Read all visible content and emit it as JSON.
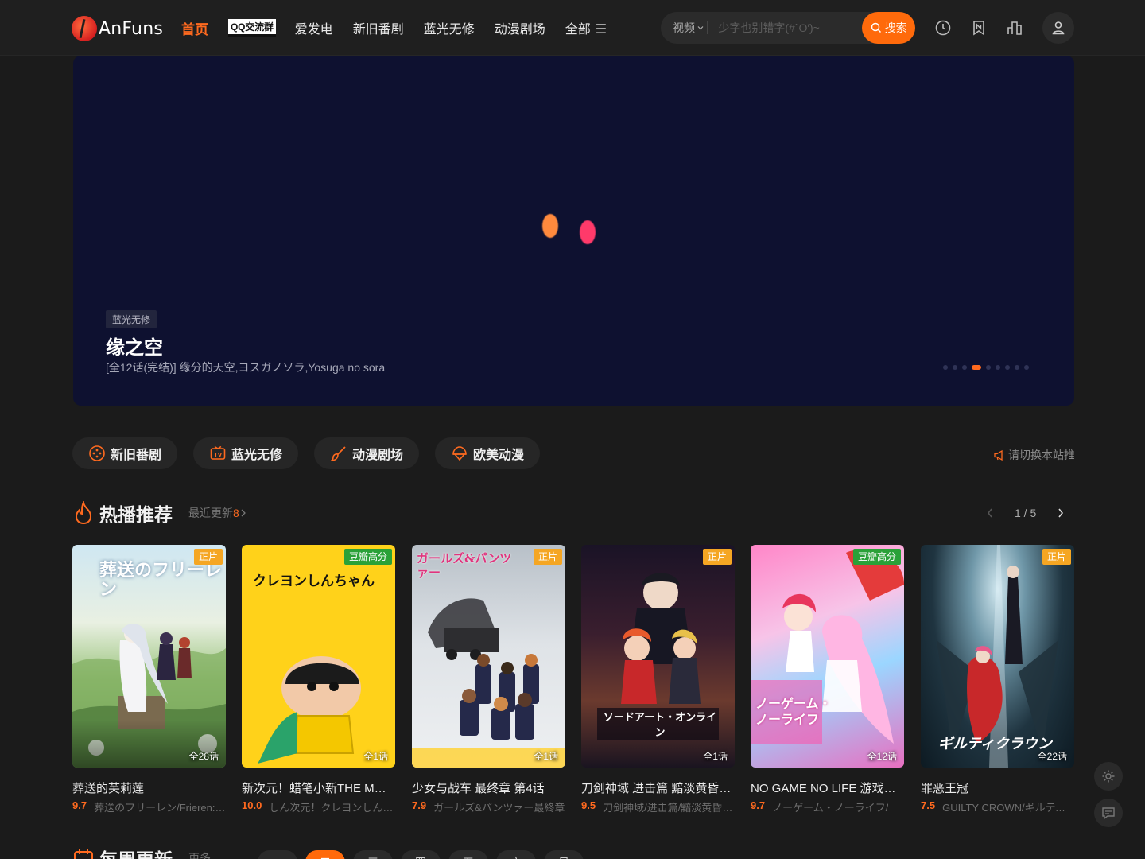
{
  "header": {
    "logo_text": "AnFuns",
    "nav": [
      {
        "label": "首页",
        "active": true
      },
      {
        "label": "QQ交流群"
      },
      {
        "label": "爱发电"
      },
      {
        "label": "新旧番剧"
      },
      {
        "label": "蓝光无修"
      },
      {
        "label": "动漫剧场"
      },
      {
        "label": "全部"
      }
    ],
    "nav_all_glyph": "☰",
    "search": {
      "type_label": "视频",
      "placeholder": "少字也别错字(#`O′)~",
      "button_label": "搜索"
    },
    "icons": [
      "history-icon",
      "bookmark-icon",
      "ranking-icon",
      "user-icon"
    ]
  },
  "banner": {
    "tag": "蓝光无修",
    "title": "缘之空",
    "subtitle": "[全12话(完结)] 缘分的天空,ヨスガノソラ,Yosuga no sora",
    "dots_total": 9,
    "dots_active_index": 3,
    "colors": {
      "background": "#0e1130",
      "loader_a": "#ff8a3d",
      "loader_b": "#ff3a6a"
    }
  },
  "categories": [
    {
      "label": "新旧番剧",
      "icon": "gamepad-icon"
    },
    {
      "label": "蓝光无修",
      "icon": "tv-icon"
    },
    {
      "label": "动漫剧场",
      "icon": "brush-icon"
    },
    {
      "label": "欧美动漫",
      "icon": "globe-icon"
    }
  ],
  "notice": {
    "text": "请切换本站推",
    "icon": "megaphone-icon"
  },
  "hot": {
    "title": "热播推荐",
    "more_label": "最近更新",
    "more_count": "8",
    "pager": "1 / 5",
    "cards": [
      {
        "title": "葬送的芙莉莲",
        "score": "9.7",
        "alias": "葬送のフリーレン/Frieren: Beyond Journey's End",
        "badge": "正片",
        "episodes": "全28话",
        "jp": "葬送のフリーレン"
      },
      {
        "title": "新次元！蜡笔小新THE MOVIE 超能力大决战",
        "score": "10.0",
        "alias": "しん次元！クレヨンしんちゃん",
        "badge": "豆瓣高分",
        "episodes": "全1话",
        "jp": "クレヨンしんちゃん"
      },
      {
        "title": "少女与战车 最终章 第4话",
        "score": "7.9",
        "alias": "ガールズ&パンツァー最終章",
        "badge": "正片",
        "episodes": "全1话",
        "jp": "ガールズ&パンツァー"
      },
      {
        "title": "刀剑神域 进击篇 黯淡黄昏的谐谑曲",
        "score": "9.5",
        "alias": "刀剑神域/进击篇/黯淡黄昏的谐谑曲",
        "badge": "正片",
        "episodes": "全1话",
        "jp": "ソードアート・オンライン"
      },
      {
        "title": "NO GAME NO LIFE 游戏人生",
        "score": "9.7",
        "alias": "ノーゲーム・ノーライフ/",
        "badge": "豆瓣高分",
        "episodes": "全12话",
        "jp": "ノーゲーム・ノーライフ"
      },
      {
        "title": "罪恶王冠",
        "score": "7.5",
        "alias": "GUILTY CROWN/ギルティクラウン",
        "badge": "正片",
        "episodes": "全22话",
        "jp": "ギルティクラウン"
      }
    ]
  },
  "weekly": {
    "title": "每周更新",
    "more_label": "更多",
    "tabs": [
      {
        "label": "一"
      },
      {
        "label": "二",
        "active": true
      },
      {
        "label": "三"
      },
      {
        "label": "四"
      },
      {
        "label": "五"
      },
      {
        "label": "六"
      },
      {
        "label": "日"
      }
    ]
  },
  "colors": {
    "accent": "#ff6a1f",
    "badge_zhengpian": "#f5a623",
    "badge_douban": "#2aa138",
    "page_bg": "#1b1b1b"
  }
}
